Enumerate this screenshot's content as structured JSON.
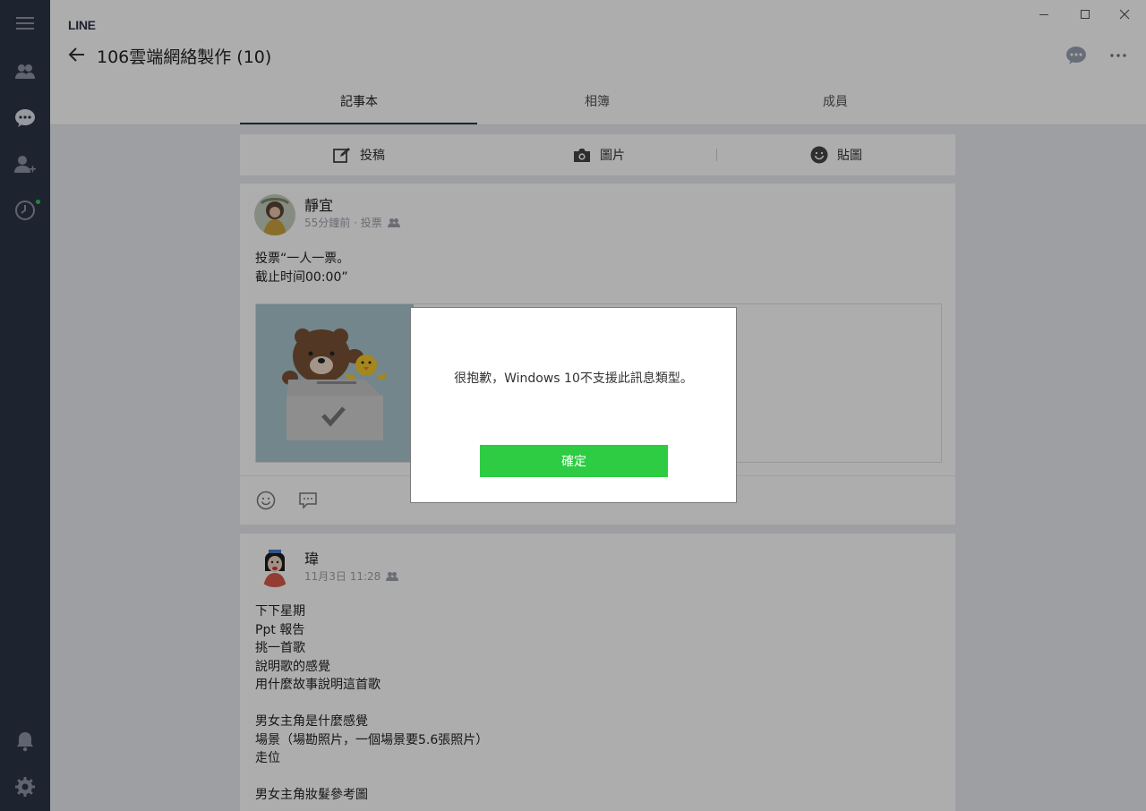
{
  "app": {
    "name": "LINE"
  },
  "window_controls": {
    "minimize": "—",
    "maximize": "☐",
    "close": "✕"
  },
  "sidebar": {
    "items": [
      {
        "icon": "menu-icon"
      },
      {
        "icon": "friends-icon"
      },
      {
        "icon": "chats-icon",
        "active": true
      },
      {
        "icon": "add-friend-icon"
      },
      {
        "icon": "timeline-icon",
        "badge": true
      }
    ],
    "bottom": [
      {
        "icon": "bell-icon"
      },
      {
        "icon": "settings-icon"
      }
    ]
  },
  "header": {
    "title": "106雲端網絡製作 (10)"
  },
  "tabs": [
    {
      "label": "記事本",
      "active": true
    },
    {
      "label": "相簿",
      "active": false
    },
    {
      "label": "成員",
      "active": false
    }
  ],
  "composer": {
    "post_label": "投稿",
    "photo_label": "圖片",
    "sticker_label": "貼圖"
  },
  "posts": [
    {
      "author": "靜宜",
      "meta": "55分鐘前 · 投票",
      "text": "投票“一人一票。\n截止时间00:00”"
    },
    {
      "author": "瑋",
      "meta": "11月3日 11:28",
      "text": "下下星期\nPpt 報告\n挑一首歌\n說明歌的感覺\n用什麼故事說明這首歌\n\n男女主角是什麼感覺\n場景（場勘照片，一個場景要5.6張照片）\n走位\n\n男女主角妝髮參考圖"
    }
  ],
  "dialog": {
    "message": "很抱歉，Windows 10不支援此訊息類型。",
    "confirm_label": "確定"
  },
  "colors": {
    "sidebar": "#2d3448",
    "accent_green": "#2ecc43",
    "badge": "#35c759"
  }
}
